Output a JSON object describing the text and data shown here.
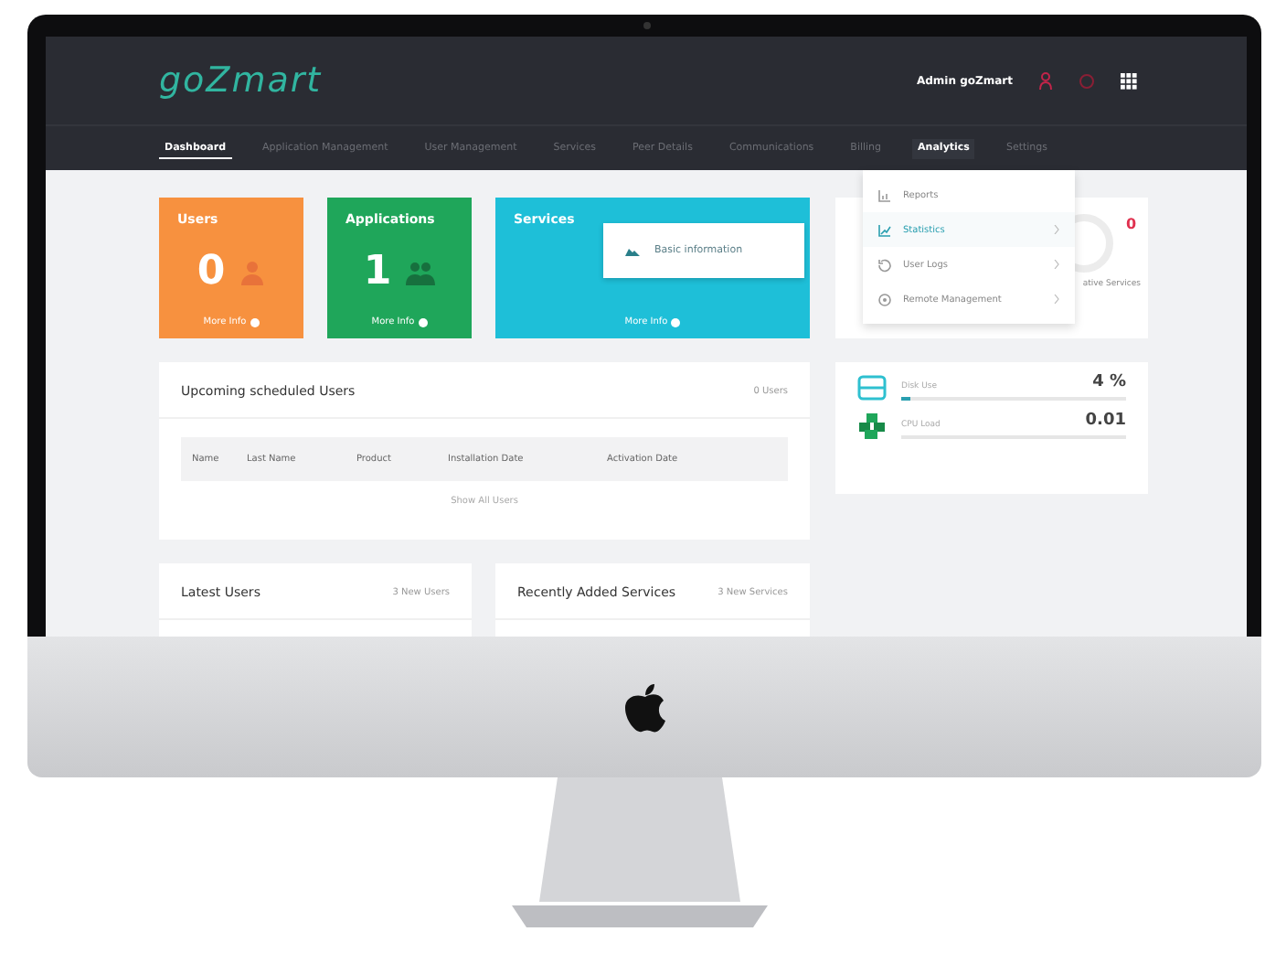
{
  "header": {
    "logo": "goZmart",
    "user": "Admin goZmart"
  },
  "nav": [
    {
      "label": "Dashboard",
      "selected": true,
      "open": false
    },
    {
      "label": "Application Management",
      "selected": false,
      "open": false
    },
    {
      "label": "User Management",
      "selected": false,
      "open": false
    },
    {
      "label": "Services",
      "selected": false,
      "open": false
    },
    {
      "label": "Peer Details",
      "selected": false,
      "open": false
    },
    {
      "label": "Communications",
      "selected": false,
      "open": false
    },
    {
      "label": "Billing",
      "selected": false,
      "open": false
    },
    {
      "label": "Analytics",
      "selected": false,
      "open": true
    },
    {
      "label": "Settings",
      "selected": false,
      "open": false
    }
  ],
  "stat_cards": [
    {
      "title": "Users",
      "count": "0",
      "link": "More Info",
      "color": "#f7913f",
      "kind": "user"
    },
    {
      "title": "Applications",
      "count": "1",
      "link": "More Info",
      "color": "#1fa65a",
      "kind": "group"
    },
    {
      "title": "Services",
      "link": "More Info",
      "color": "#1ebfd8",
      "kind": "service"
    }
  ],
  "popup": {
    "label": "Basic information"
  },
  "analytics_menu": [
    {
      "label": "Reports",
      "selected": false,
      "submenu": false,
      "kind": "chart"
    },
    {
      "label": "Statistics",
      "selected": true,
      "submenu": true,
      "kind": "trend"
    },
    {
      "label": "User Logs",
      "selected": false,
      "submenu": true,
      "kind": "history"
    },
    {
      "label": "Remote Management",
      "selected": false,
      "submenu": true,
      "kind": "remote"
    }
  ],
  "services_gauge": {
    "value": "0",
    "label": "ative Services"
  },
  "upcoming": {
    "title": "Upcoming scheduled Users",
    "count": "0 Users",
    "columns": [
      "Name",
      "Last Name",
      "Product",
      "Installation Date",
      "Activation Date"
    ],
    "link": "Show All Users"
  },
  "resources": [
    {
      "kind": "disk",
      "label": "Disk Use",
      "value": "4 %",
      "level": 0.04
    },
    {
      "kind": "cpu",
      "label": "CPU Load",
      "value": "0.01",
      "level": 0
    }
  ],
  "latest_users": {
    "title": "Latest Users",
    "count": "3 New Users"
  },
  "recent_services": {
    "title": "Recently Added Services",
    "count": "3 New Services"
  }
}
